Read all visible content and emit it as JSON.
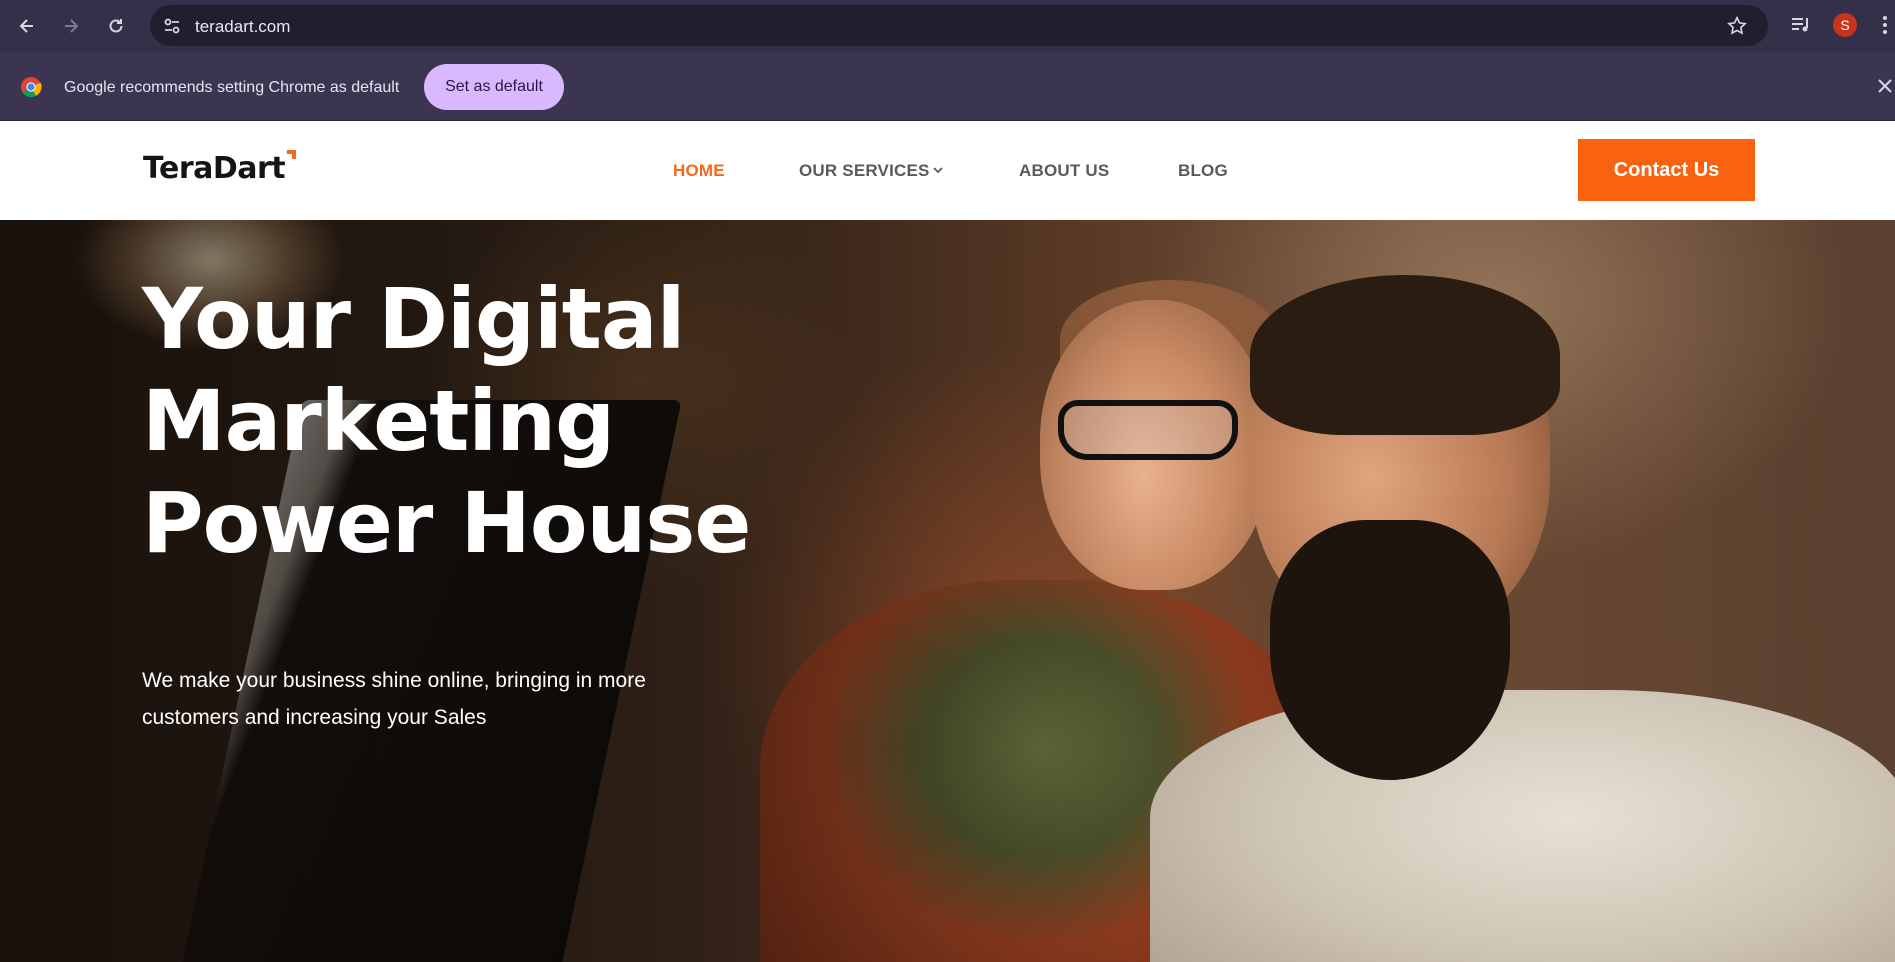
{
  "browser": {
    "url": "teradart.com",
    "avatar_letter": "S",
    "icons": [
      "back-icon",
      "forward-icon",
      "reload-icon",
      "site-settings-icon",
      "bookmark-star-icon",
      "media-controls-icon",
      "more-menu-icon"
    ]
  },
  "infobar": {
    "message": "Google recommends setting Chrome as default",
    "button_label": "Set as default"
  },
  "site": {
    "logo": "TeraDart",
    "nav": {
      "home": "HOME",
      "services": "OUR SERVICES",
      "about": "ABOUT US",
      "blog": "BLOG"
    },
    "contact_label": "Contact Us",
    "colors": {
      "accent": "#f9620f",
      "nav_active": "#f26a1b",
      "nav_text": "#5a5a5a"
    }
  },
  "hero": {
    "title_lines": [
      "Your Digital",
      "Marketing",
      "Power House"
    ],
    "subtitle": "We make your business shine online, bringing in more customers and increasing your Sales"
  }
}
